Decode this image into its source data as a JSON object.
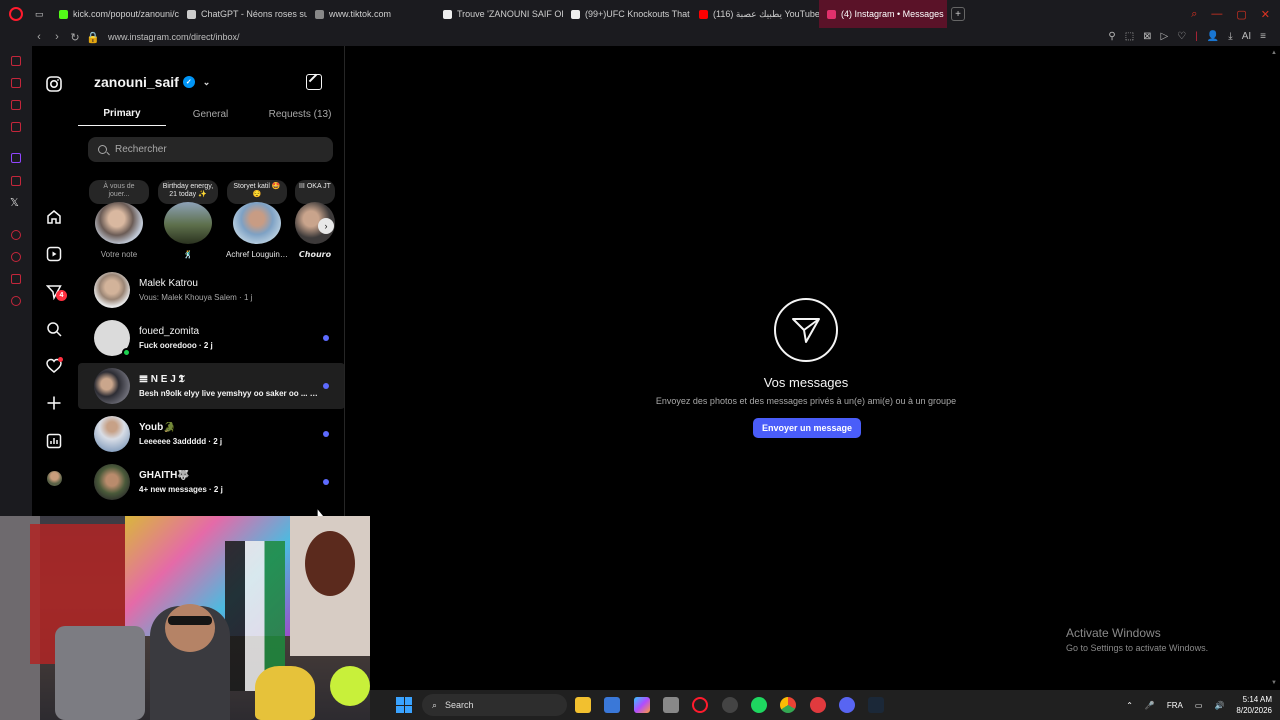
{
  "browser": {
    "tabs": [
      {
        "label": "kick.com/popout/zanouni/c",
        "color": "#53fc18"
      },
      {
        "label": "ChatGPT - Néons roses su",
        "color": "#cccccc"
      },
      {
        "label": "www.tiktok.com",
        "color": "#888888"
      },
      {
        "label": "Trouve 'ZANOUNI SAIF OF",
        "color": "#eeeeee"
      },
      {
        "label": "(99+)UFC Knockouts That",
        "color": "#eeeeee"
      },
      {
        "label": "يطبيك عصبة (116) YouTube",
        "color": "#ff0000"
      },
      {
        "label": "(4) Instagram • Messages",
        "color": "#e1306c",
        "active": true
      }
    ],
    "url": "www.instagram.com/direct/inbox/",
    "ai_label": "AI"
  },
  "inbox": {
    "username": "zanouni_saif",
    "tabs": [
      "Primary",
      "General",
      "Requests (13)"
    ],
    "search_placeholder": "Rechercher",
    "notes": [
      {
        "bubble": "À vous de jouer...",
        "label": "Votre note"
      },
      {
        "bubble": "Birthday energy, 21 today ✨",
        "label": "🕺"
      },
      {
        "bubble": "Storyet katil 🤩😌",
        "label": "Achref Louguini ..."
      },
      {
        "bubble": "III OKA JT",
        "label": "𝘾𝙝𝙤𝙪𝙧𝙤"
      }
    ],
    "conversations": [
      {
        "name": "Malek Katrou",
        "preview": "Vous: Malek Khouya Salem · 1 j",
        "unread": false
      },
      {
        "name": "foued_zomita",
        "preview": "Fuck ooredooo · 2 j",
        "unread": true
      },
      {
        "name": "𝌆 N E J 𝕿",
        "preview": "Besh n9olk elyy live yemshyy oo saker oo ... · 2 j",
        "unread": true
      },
      {
        "name": "Youb🐊",
        "preview": "Leeeeee 3addddd · 2 j",
        "unread": true
      },
      {
        "name": "GHAITH🐺",
        "preview": "4+ new messages · 2 j",
        "unread": true
      }
    ]
  },
  "nav": {
    "messages_badge": "4"
  },
  "empty_state": {
    "title": "Vos messages",
    "subtitle": "Envoyez des photos et des messages privés à un(e) ami(e) ou à un groupe",
    "button": "Envoyer un message"
  },
  "watermark": {
    "line1": "Activate Windows",
    "line2": "Go to Settings to activate Windows."
  },
  "taskbar": {
    "search": "Search",
    "lang": "FRA",
    "time": "5:14 AM",
    "date": "8/20/2026"
  }
}
